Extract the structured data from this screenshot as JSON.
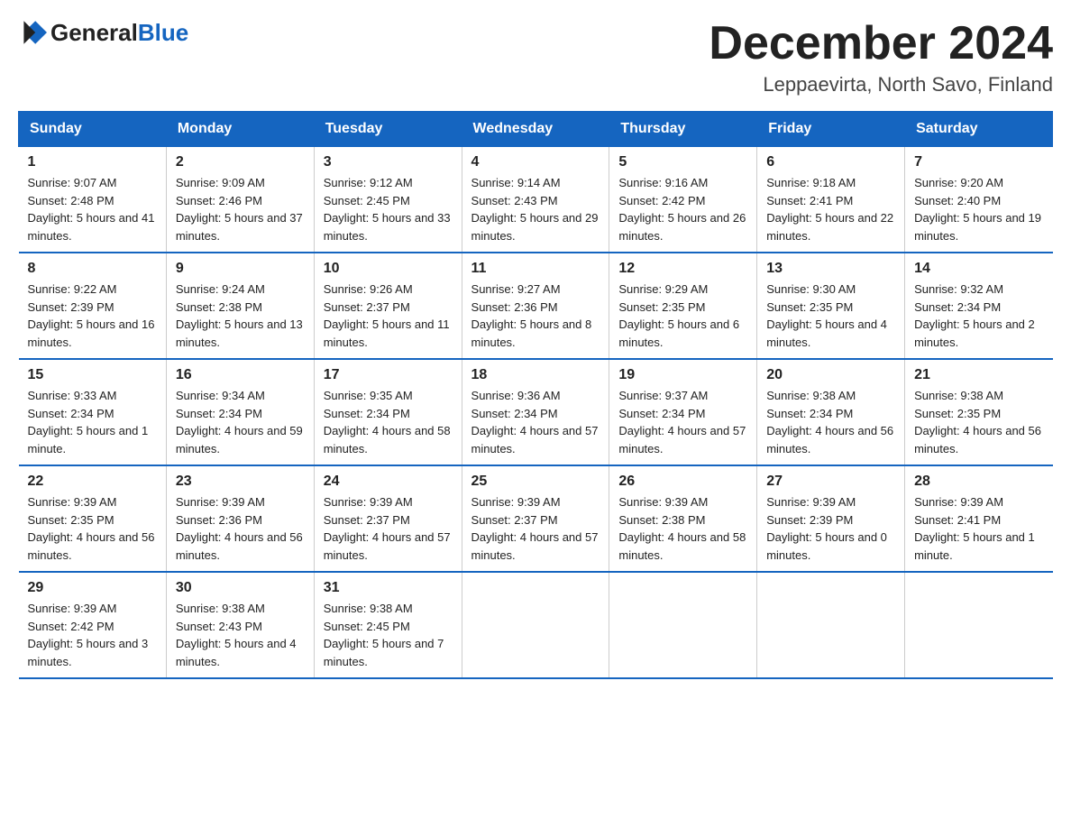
{
  "header": {
    "logo": {
      "text_general": "General",
      "text_blue": "Blue"
    },
    "title": "December 2024",
    "subtitle": "Leppaevirta, North Savo, Finland"
  },
  "calendar": {
    "weekdays": [
      "Sunday",
      "Monday",
      "Tuesday",
      "Wednesday",
      "Thursday",
      "Friday",
      "Saturday"
    ],
    "weeks": [
      [
        {
          "day": "1",
          "sunrise": "9:07 AM",
          "sunset": "2:48 PM",
          "daylight": "5 hours and 41 minutes."
        },
        {
          "day": "2",
          "sunrise": "9:09 AM",
          "sunset": "2:46 PM",
          "daylight": "5 hours and 37 minutes."
        },
        {
          "day": "3",
          "sunrise": "9:12 AM",
          "sunset": "2:45 PM",
          "daylight": "5 hours and 33 minutes."
        },
        {
          "day": "4",
          "sunrise": "9:14 AM",
          "sunset": "2:43 PM",
          "daylight": "5 hours and 29 minutes."
        },
        {
          "day": "5",
          "sunrise": "9:16 AM",
          "sunset": "2:42 PM",
          "daylight": "5 hours and 26 minutes."
        },
        {
          "day": "6",
          "sunrise": "9:18 AM",
          "sunset": "2:41 PM",
          "daylight": "5 hours and 22 minutes."
        },
        {
          "day": "7",
          "sunrise": "9:20 AM",
          "sunset": "2:40 PM",
          "daylight": "5 hours and 19 minutes."
        }
      ],
      [
        {
          "day": "8",
          "sunrise": "9:22 AM",
          "sunset": "2:39 PM",
          "daylight": "5 hours and 16 minutes."
        },
        {
          "day": "9",
          "sunrise": "9:24 AM",
          "sunset": "2:38 PM",
          "daylight": "5 hours and 13 minutes."
        },
        {
          "day": "10",
          "sunrise": "9:26 AM",
          "sunset": "2:37 PM",
          "daylight": "5 hours and 11 minutes."
        },
        {
          "day": "11",
          "sunrise": "9:27 AM",
          "sunset": "2:36 PM",
          "daylight": "5 hours and 8 minutes."
        },
        {
          "day": "12",
          "sunrise": "9:29 AM",
          "sunset": "2:35 PM",
          "daylight": "5 hours and 6 minutes."
        },
        {
          "day": "13",
          "sunrise": "9:30 AM",
          "sunset": "2:35 PM",
          "daylight": "5 hours and 4 minutes."
        },
        {
          "day": "14",
          "sunrise": "9:32 AM",
          "sunset": "2:34 PM",
          "daylight": "5 hours and 2 minutes."
        }
      ],
      [
        {
          "day": "15",
          "sunrise": "9:33 AM",
          "sunset": "2:34 PM",
          "daylight": "5 hours and 1 minute."
        },
        {
          "day": "16",
          "sunrise": "9:34 AM",
          "sunset": "2:34 PM",
          "daylight": "4 hours and 59 minutes."
        },
        {
          "day": "17",
          "sunrise": "9:35 AM",
          "sunset": "2:34 PM",
          "daylight": "4 hours and 58 minutes."
        },
        {
          "day": "18",
          "sunrise": "9:36 AM",
          "sunset": "2:34 PM",
          "daylight": "4 hours and 57 minutes."
        },
        {
          "day": "19",
          "sunrise": "9:37 AM",
          "sunset": "2:34 PM",
          "daylight": "4 hours and 57 minutes."
        },
        {
          "day": "20",
          "sunrise": "9:38 AM",
          "sunset": "2:34 PM",
          "daylight": "4 hours and 56 minutes."
        },
        {
          "day": "21",
          "sunrise": "9:38 AM",
          "sunset": "2:35 PM",
          "daylight": "4 hours and 56 minutes."
        }
      ],
      [
        {
          "day": "22",
          "sunrise": "9:39 AM",
          "sunset": "2:35 PM",
          "daylight": "4 hours and 56 minutes."
        },
        {
          "day": "23",
          "sunrise": "9:39 AM",
          "sunset": "2:36 PM",
          "daylight": "4 hours and 56 minutes."
        },
        {
          "day": "24",
          "sunrise": "9:39 AM",
          "sunset": "2:37 PM",
          "daylight": "4 hours and 57 minutes."
        },
        {
          "day": "25",
          "sunrise": "9:39 AM",
          "sunset": "2:37 PM",
          "daylight": "4 hours and 57 minutes."
        },
        {
          "day": "26",
          "sunrise": "9:39 AM",
          "sunset": "2:38 PM",
          "daylight": "4 hours and 58 minutes."
        },
        {
          "day": "27",
          "sunrise": "9:39 AM",
          "sunset": "2:39 PM",
          "daylight": "5 hours and 0 minutes."
        },
        {
          "day": "28",
          "sunrise": "9:39 AM",
          "sunset": "2:41 PM",
          "daylight": "5 hours and 1 minute."
        }
      ],
      [
        {
          "day": "29",
          "sunrise": "9:39 AM",
          "sunset": "2:42 PM",
          "daylight": "5 hours and 3 minutes."
        },
        {
          "day": "30",
          "sunrise": "9:38 AM",
          "sunset": "2:43 PM",
          "daylight": "5 hours and 4 minutes."
        },
        {
          "day": "31",
          "sunrise": "9:38 AM",
          "sunset": "2:45 PM",
          "daylight": "5 hours and 7 minutes."
        },
        null,
        null,
        null,
        null
      ]
    ]
  }
}
